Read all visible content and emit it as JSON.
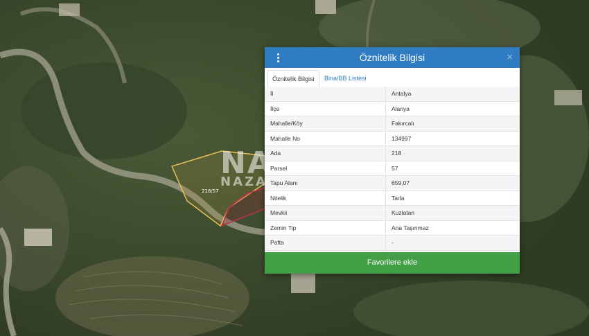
{
  "map": {
    "parcel_label": "218/57",
    "watermark": {
      "main": "NAZAR",
      "sub": "NAZAR"
    }
  },
  "panel": {
    "title": "Öznitelik Bilgisi",
    "close_glyph": "×",
    "tabs": [
      {
        "label": "Öznitelik Bilgisi",
        "active": true
      },
      {
        "label": "Bina/BB Listesi",
        "active": false
      }
    ],
    "rows": [
      {
        "key": "İl",
        "value": "Antalya"
      },
      {
        "key": "İlçe",
        "value": "Alanya"
      },
      {
        "key": "Mahalle/Köy",
        "value": "Fakırcalı"
      },
      {
        "key": "Mahalle No",
        "value": "134997"
      },
      {
        "key": "Ada",
        "value": "218"
      },
      {
        "key": "Parsel",
        "value": "57"
      },
      {
        "key": "Tapu Alanı",
        "value": "659,07"
      },
      {
        "key": "Nitelik",
        "value": "Tarla"
      },
      {
        "key": "Mevkii",
        "value": "Kuzlatan"
      },
      {
        "key": "Zemin Tip",
        "value": "Ana Taşınmaz"
      },
      {
        "key": "Pafta",
        "value": "-"
      }
    ],
    "favorite_button": "Favorilere ekle"
  },
  "colors": {
    "header": "#2f7cc2",
    "button": "#43a047",
    "parcel_outline": "#e8c15a",
    "neighbor_outline": "#c0304a"
  }
}
